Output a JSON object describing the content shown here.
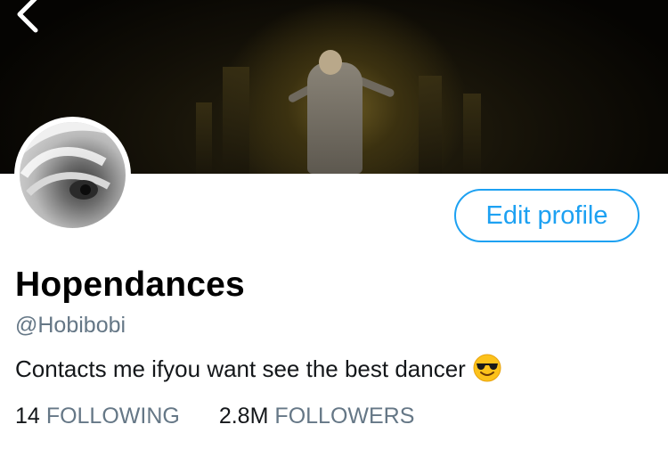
{
  "profile": {
    "display_name": "Hopendances",
    "handle": "@Hobibobi",
    "bio": "Contacts me ifyou want see the best dancer",
    "bio_emoji": "smiling-face-with-sunglasses-icon",
    "edit_button_label": "Edit profile",
    "following_count": "14",
    "following_label": "FOLLOWING",
    "followers_count": "2.8M",
    "followers_label": "FOLLOWERS"
  },
  "icons": {
    "back": "chevron-left-icon"
  },
  "colors": {
    "accent": "#1da1f2",
    "secondary_text": "#657786",
    "primary_text": "#14171a"
  }
}
